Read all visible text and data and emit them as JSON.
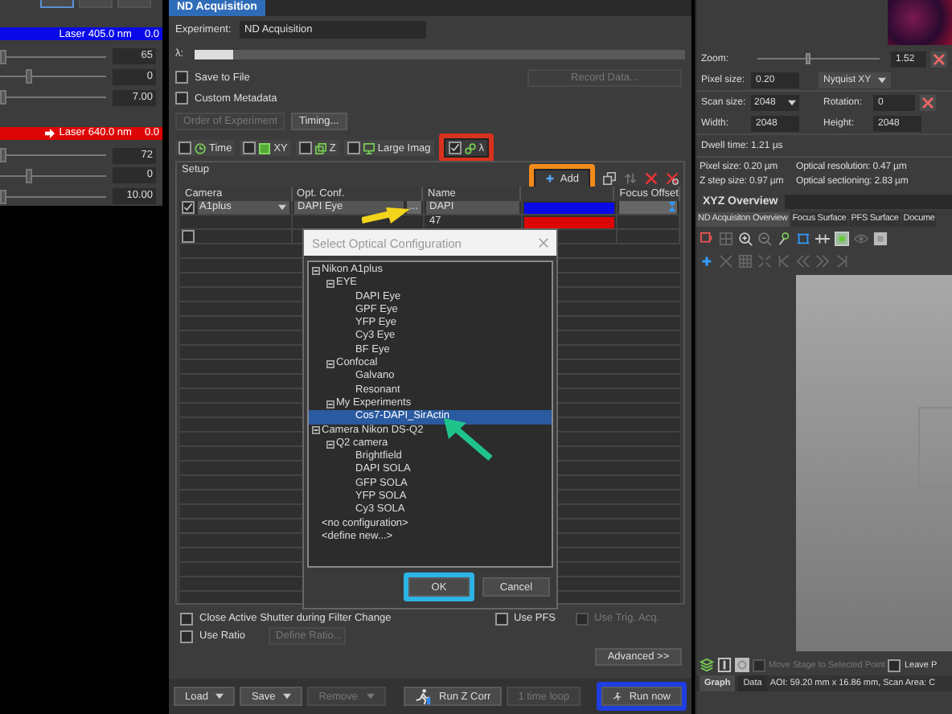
{
  "left_panel": {
    "top_buttons": [
      {
        "selected": true
      },
      {
        "selected": false
      },
      {
        "selected": false
      }
    ],
    "lasers": [
      {
        "label": "Laser 405.0 nm",
        "value": "0.0",
        "color": "#0a0ae8",
        "active": false,
        "rows": [
          {
            "value": "65",
            "level": 0
          },
          {
            "value": "0",
            "level": 0.26
          },
          {
            "value": "7.00",
            "level": 0
          }
        ]
      },
      {
        "label": "Laser 640.0 nm",
        "value": "0.0",
        "color": "#dd0606",
        "active": true,
        "rows": [
          {
            "value": "72",
            "level": 0
          },
          {
            "value": "0",
            "level": 0.26
          },
          {
            "value": "10.00",
            "level": 0
          }
        ]
      }
    ]
  },
  "nd_acquisition": {
    "tab": "ND Acquisition",
    "experiment_label": "Experiment:",
    "experiment": "ND Acquisition",
    "lambda_label": "λ:",
    "progress": {
      "level": 0.08
    },
    "save_to_file": {
      "label": "Save to File",
      "checked": false
    },
    "record_button": {
      "label": "Record Data...",
      "disabled": true
    },
    "custom_metadata": {
      "label": "Custom Metadata",
      "checked": false
    },
    "order_dropdown": {
      "label": "Order of Experiment",
      "disabled": true
    },
    "timing_button": "Timing...",
    "dimension_tabs": [
      {
        "kind": "time",
        "label": "Time",
        "checked": false
      },
      {
        "kind": "xy",
        "label": "XY",
        "checked": false
      },
      {
        "kind": "z",
        "label": "Z",
        "checked": false
      },
      {
        "kind": "large",
        "label": "Large Imag",
        "checked": false
      },
      {
        "kind": "lambda",
        "label": "λ",
        "checked": true,
        "frame": {
          "color": "#d8321e"
        }
      }
    ],
    "setup": {
      "title": "Setup",
      "add_button": {
        "label": "Add",
        "frame": {
          "color": "#f28a1a"
        }
      }
    },
    "table": {
      "columns": [
        "Camera",
        "Opt. Conf.",
        "Name",
        "Focus Offset"
      ],
      "rows": [
        {
          "checked": true,
          "camera": "A1plus",
          "opt_conf": "DAPI Eye",
          "browse": "...",
          "name": "DAPI",
          "color": "#0a0ae8",
          "focus_icon": true
        },
        {
          "name": "47",
          "color": "#dd0606"
        },
        {
          "checked": false
        }
      ]
    },
    "dialog": {
      "title": "Select Optical Configuration",
      "tree": [
        {
          "label": "Nikon A1plus",
          "expanded": true,
          "selected": false,
          "children": [
            {
              "label": "EYE",
              "expanded": true,
              "selected": false,
              "children": [
                {
                  "label": "DAPI Eye",
                  "selected": false
                },
                {
                  "label": "GPF Eye",
                  "selected": false
                },
                {
                  "label": "YFP Eye",
                  "selected": false
                },
                {
                  "label": "Cy3 Eye",
                  "selected": false
                },
                {
                  "label": "BF Eye",
                  "selected": false
                }
              ]
            },
            {
              "label": "Confocal",
              "expanded": true,
              "selected": false,
              "children": [
                {
                  "label": "Galvano",
                  "selected": false
                },
                {
                  "label": "Resonant",
                  "selected": false
                }
              ]
            },
            {
              "label": "My Experiments",
              "expanded": true,
              "selected": false,
              "children": [
                {
                  "label": "Cos7-DAPI_SirActin",
                  "selected": true
                }
              ]
            }
          ]
        },
        {
          "label": "Camera Nikon DS-Q2",
          "expanded": true,
          "selected": false,
          "children": [
            {
              "label": "Q2 camera",
              "expanded": true,
              "selected": false,
              "children": [
                {
                  "label": "Brightfield",
                  "selected": false
                },
                {
                  "label": "DAPI SOLA",
                  "selected": false
                },
                {
                  "label": "GFP SOLA",
                  "selected": false
                },
                {
                  "label": "YFP SOLA",
                  "selected": false
                },
                {
                  "label": "Cy3 SOLA",
                  "selected": false
                }
              ]
            }
          ]
        },
        {
          "label": "<no configuration>",
          "selected": false
        },
        {
          "label": "<define new...>",
          "selected": false
        }
      ],
      "ok_button": {
        "label": "OK",
        "frame": {
          "color": "#2cb4e6"
        }
      },
      "cancel_button": "Cancel"
    },
    "options": {
      "close_shutter": {
        "label": "Close Active Shutter during Filter Change",
        "checked": false
      },
      "use_pfs": {
        "label": "Use PFS",
        "checked": false
      },
      "use_trig": {
        "label": "Use Trig. Acq.",
        "checked": false,
        "disabled": true
      },
      "use_ratio": {
        "label": "Use Ratio",
        "checked": false
      },
      "define_ratio": {
        "label": "Define Ratio...",
        "disabled": true
      },
      "advanced": "Advanced >>"
    },
    "bottom_buttons": [
      {
        "kind": "menu",
        "label": "Load",
        "disabled": false
      },
      {
        "kind": "menu",
        "label": "Save",
        "disabled": false
      },
      {
        "kind": "menu",
        "label": "Remove",
        "disabled": true
      },
      {
        "kind": "runz",
        "label": "Run Z Corr",
        "disabled": false
      },
      {
        "kind": "plain",
        "label": "1 time loop",
        "disabled": true
      },
      {
        "kind": "run",
        "label": "Run now",
        "disabled": false,
        "frame": {
          "color": "#1e3ee0"
        }
      }
    ]
  },
  "annotations": [
    {
      "kind": "arrow",
      "color": "#f2d41c"
    },
    {
      "kind": "arrow",
      "color": "#20c48a"
    }
  ],
  "scan_panel": {
    "zoom": {
      "label": "Zoom:",
      "level": 0.42,
      "value": "1.52"
    },
    "pixel_size": {
      "label": "Pixel size:",
      "value": "0.20",
      "dropdown": "Nyquist XY"
    },
    "scan_size": {
      "label": "Scan size:",
      "value": "2048"
    },
    "rotation": {
      "label": "Rotation:",
      "value": "0"
    },
    "width": {
      "label": "Width:",
      "value": "2048"
    },
    "height": {
      "label": "Height:",
      "value": "2048"
    },
    "dwell": "Dwell time: 1.21 µs",
    "info": [
      "Pixel size: 0.20 µm",
      "Optical resolution: 0.47 µm",
      "Z step size: 0.97 µm",
      "Optical sectioning: 2.83 µm"
    ]
  },
  "overview": {
    "title": "XYZ Overview",
    "tabs": [
      {
        "label": "ND Acquisiton Overview",
        "selected": true
      },
      {
        "label": "Focus Surface",
        "selected": false
      },
      {
        "label": "PFS Surface",
        "selected": false
      },
      {
        "label": "Docume",
        "selected": false
      }
    ],
    "move_stage": {
      "label": "Move Stage to Selected Point",
      "checked": false,
      "disabled": true
    },
    "leave": {
      "label": "Leave P",
      "checked": false
    },
    "bottom_tabs": [
      {
        "label": "Graph",
        "selected": true
      },
      {
        "label": "Data",
        "selected": false
      }
    ],
    "status": "AOI: 59.20 mm x 16.86 mm, Scan Area: C"
  }
}
